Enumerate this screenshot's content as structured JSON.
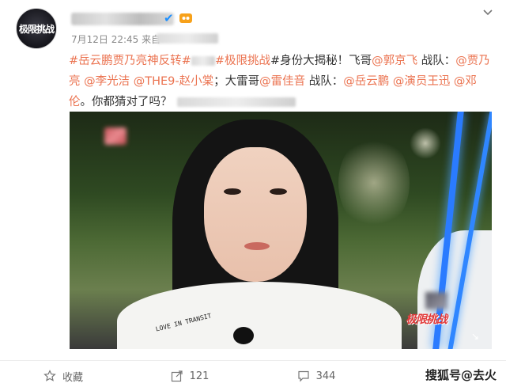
{
  "post": {
    "date_text": "7月12日 22:45 来自",
    "avatar_logo": "极限挑战",
    "content": {
      "t1": "#岳云鹏贾乃亮神反转#",
      "t2": "#极限挑战",
      "t3": "#身份大揭秘！飞哥",
      "m1": "@郭京飞",
      "t4": " 战队：",
      "m2": "@贾乃亮",
      "m3": " @李光洁",
      "m4": " @THE9-赵小棠",
      "t5": "；大雷哥",
      "m5": "@雷佳音",
      "t6": " 战队：",
      "m6": "@岳云鹏",
      "m7": " @演员王迅",
      "m8": " @邓伦",
      "t7": "。你都猜对了吗？"
    },
    "photo": {
      "shirt_text": "LOVE IN TRANSIT",
      "logo_text": "极限挑战"
    }
  },
  "actions": {
    "favorite_label": "收藏",
    "repost_count": "121",
    "comment_count": "344",
    "watermark": "搜狐号@去火"
  }
}
